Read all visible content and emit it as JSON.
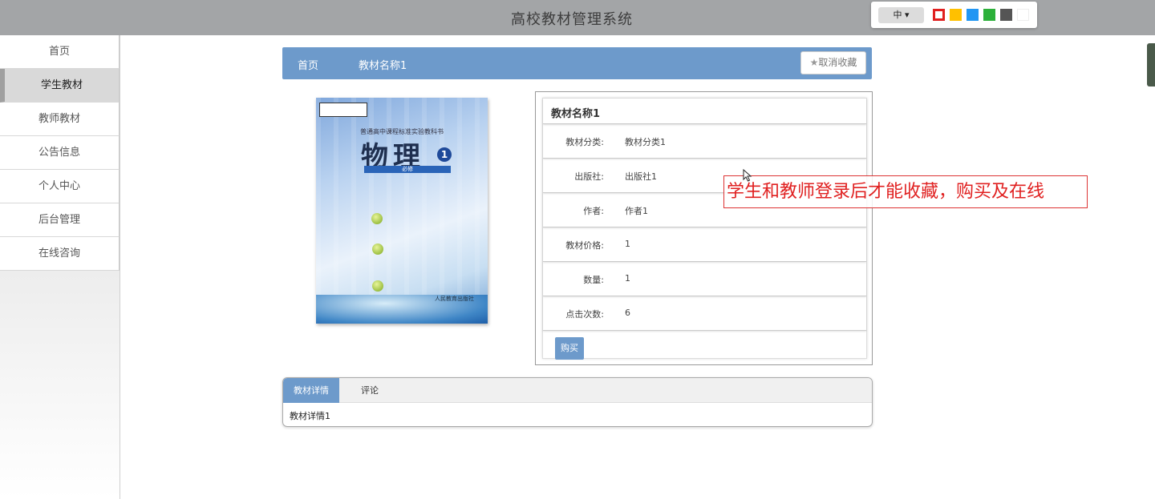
{
  "header": {
    "title": "高校教材管理系统",
    "font_size_select": "中",
    "theme_swatches": [
      "#e02020",
      "#ffc000",
      "#2196f3",
      "#2cb03a",
      "#555555",
      "#ffffff"
    ]
  },
  "sidebar": {
    "items": [
      {
        "label": "首页",
        "active": false
      },
      {
        "label": "学生教材",
        "active": true
      },
      {
        "label": "教师教材",
        "active": false
      },
      {
        "label": "公告信息",
        "active": false
      },
      {
        "label": "个人中心",
        "active": false
      },
      {
        "label": "后台管理",
        "active": false
      },
      {
        "label": "在线咨询",
        "active": false
      }
    ]
  },
  "breadcrumb": {
    "home": "首页",
    "current": "教材名称1",
    "fav_label": "取消收藏"
  },
  "book_cover": {
    "series": "普通高中课程标准实验教科书",
    "subject": "物理",
    "volume": "1",
    "edition": "必修",
    "publisher": "人民教育出版社"
  },
  "info": {
    "title": "教材名称1",
    "rows": [
      {
        "label": "教材分类:",
        "value": "教材分类1"
      },
      {
        "label": "出版社:",
        "value": "出版社1"
      },
      {
        "label": "作者:",
        "value": "作者1"
      },
      {
        "label": "教材价格:",
        "value": "1"
      },
      {
        "label": "数量:",
        "value": "1"
      },
      {
        "label": "点击次数:",
        "value": "6"
      }
    ],
    "buy_label": "购买"
  },
  "annotation": "学生和教师登录后才能收藏，购买及在线",
  "tabs": {
    "items": [
      "教材详情",
      "评论"
    ],
    "content": "教材详情1"
  }
}
